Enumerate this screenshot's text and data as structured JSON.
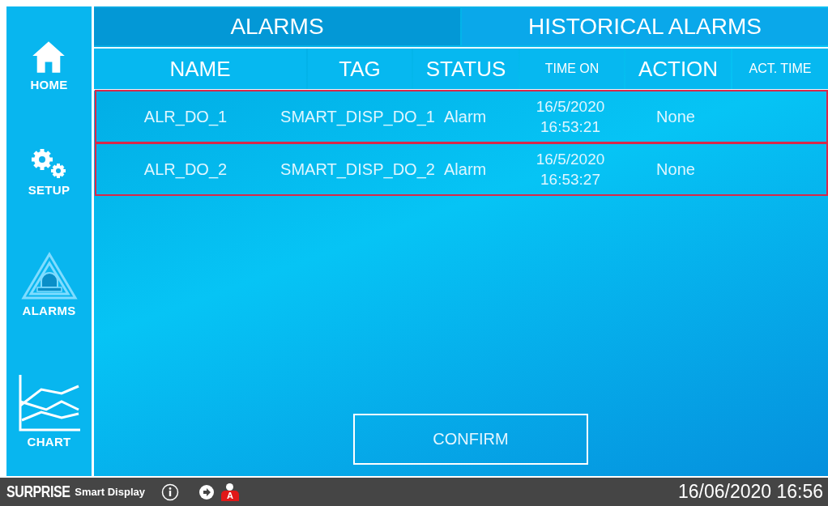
{
  "sidebar": {
    "items": [
      {
        "label": "HOME"
      },
      {
        "label": "SETUP"
      },
      {
        "label": "ALARMS"
      },
      {
        "label": "CHART"
      }
    ]
  },
  "tabs": [
    {
      "label": "ALARMS",
      "selected": true
    },
    {
      "label": "HISTORICAL ALARMS",
      "selected": false
    }
  ],
  "table": {
    "columns": [
      {
        "label": "NAME",
        "kind": "large"
      },
      {
        "label": "TAG",
        "kind": "large"
      },
      {
        "label": "STATUS",
        "kind": "large"
      },
      {
        "label": "TIME ON",
        "kind": "small"
      },
      {
        "label": "ACTION",
        "kind": "large"
      },
      {
        "label": "ACT. TIME",
        "kind": "small"
      }
    ],
    "rows": [
      {
        "name": "ALR_DO_1",
        "tag": "SMART_DISP_DO_1",
        "status": "Alarm",
        "time_on": [
          "16/5/2020",
          "16:53:21"
        ],
        "action": "None"
      },
      {
        "name": "ALR_DO_2",
        "tag": "SMART_DISP_DO_2",
        "status": "Alarm",
        "time_on": [
          "16/5/2020",
          "16:53:27"
        ],
        "action": "None"
      }
    ]
  },
  "confirm_button": "CONFIRM",
  "status_bar": {
    "brand": "SURPRISE",
    "product": "Smart Display",
    "user_level": "A",
    "datetime": "16/06/2020 16:56"
  }
}
